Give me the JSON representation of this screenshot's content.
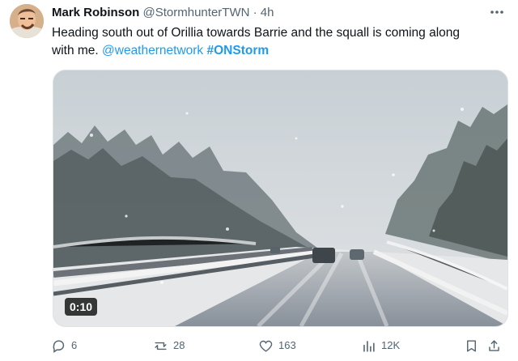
{
  "author": {
    "name": "Mark Robinson",
    "handle": "@StormhunterTWN",
    "separator": "·",
    "time": "4h",
    "avatar_icon": "profile-photo"
  },
  "tweet": {
    "text_line_1": "Heading south out of Orillia towards Barrie and the squall is coming along",
    "text_line_2_start": "with me. ",
    "mention": "@weathernetwork",
    "hashtag": "#ONStorm"
  },
  "media": {
    "duration": "0:10"
  },
  "actions": {
    "replies": "6",
    "reposts": "28",
    "likes": "163",
    "views": "12K"
  },
  "colors": {
    "link": "#1d9bf0",
    "text": "#0f1419",
    "secondary": "#536471"
  }
}
